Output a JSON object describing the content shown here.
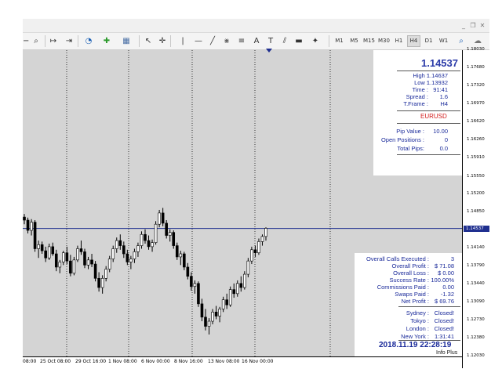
{
  "window": {
    "controls": [
      {
        "name": "minimize-button",
        "glyph": "_"
      },
      {
        "name": "restore-button",
        "glyph": "❐"
      },
      {
        "name": "close-button",
        "glyph": "✕"
      }
    ]
  },
  "toolbar": {
    "icons": [
      {
        "name": "zoom-out-icon",
        "glyph": "−"
      },
      {
        "name": "zoom-icon",
        "glyph": "⌕"
      },
      {
        "name": "chart-shift-icon",
        "glyph": "↦"
      },
      {
        "name": "autoscroll-icon",
        "glyph": "⇥"
      },
      {
        "name": "clock-icon",
        "glyph": "◔"
      },
      {
        "name": "add-indicator-icon",
        "glyph": "✚"
      },
      {
        "name": "templates-icon",
        "glyph": "▦"
      },
      {
        "name": "cursor-icon",
        "glyph": "↖"
      },
      {
        "name": "crosshair-icon",
        "glyph": "✛"
      },
      {
        "name": "vertical-line-icon",
        "glyph": "|"
      },
      {
        "name": "horizontal-line-icon",
        "glyph": "—"
      },
      {
        "name": "trendline-icon",
        "glyph": "╱"
      },
      {
        "name": "channel-icon",
        "glyph": "⨳"
      },
      {
        "name": "fibonacci-icon",
        "glyph": "≡"
      },
      {
        "name": "text-icon",
        "glyph": "A"
      },
      {
        "name": "text-label-icon",
        "glyph": "T"
      },
      {
        "name": "gann-icon",
        "glyph": "⫽"
      },
      {
        "name": "rectangle-icon",
        "glyph": "▬"
      },
      {
        "name": "shapes-icon",
        "glyph": "✦"
      }
    ],
    "timeframes": [
      "M1",
      "M5",
      "M15",
      "M30",
      "H1",
      "H4",
      "D1",
      "W1"
    ],
    "active_timeframe": "H4",
    "search_icon": "⌕",
    "chat_icon": "☁"
  },
  "chart": {
    "symbol": "EURUSD",
    "timeframe": "H4",
    "price_axis": [
      "1.18030",
      "1.17680",
      "1.17320",
      "1.16970",
      "1.16620",
      "1.16260",
      "1.15910",
      "1.15550",
      "1.15200",
      "1.14850",
      "1.14537",
      "1.14140",
      "1.13790",
      "1.13440",
      "1.13090",
      "1.12730",
      "1.12380",
      "1.12030"
    ],
    "current_price_label": "1.14537",
    "time_axis": [
      "08:00",
      "25 Oct 08:00",
      "29 Oct 16:00",
      "1 Nov 08:00",
      "6 Nov 00:00",
      "8 Nov 16:00",
      "13 Nov 08:00",
      "16 Nov 00:00"
    ],
    "colors": {
      "background": "#d4d4d4",
      "bull": "#ffffff",
      "bear": "#000000",
      "price_line": "#1f2f8f"
    },
    "candles": [
      [
        1.1476,
        1.1482,
        1.1462,
        1.147
      ],
      [
        1.147,
        1.1475,
        1.1444,
        1.145
      ],
      [
        1.145,
        1.1472,
        1.144,
        1.1466
      ],
      [
        1.1466,
        1.147,
        1.1408,
        1.1414
      ],
      [
        1.1414,
        1.143,
        1.1396,
        1.1422
      ],
      [
        1.1422,
        1.1428,
        1.1404,
        1.141
      ],
      [
        1.141,
        1.1418,
        1.1388,
        1.1396
      ],
      [
        1.1396,
        1.1424,
        1.1392,
        1.1418
      ],
      [
        1.1418,
        1.1426,
        1.14,
        1.1404
      ],
      [
        1.1404,
        1.1412,
        1.137,
        1.1378
      ],
      [
        1.1378,
        1.1392,
        1.1366,
        1.1388
      ],
      [
        1.1388,
        1.141,
        1.1382,
        1.1406
      ],
      [
        1.1406,
        1.1418,
        1.1384,
        1.139
      ],
      [
        1.139,
        1.1402,
        1.136,
        1.1366
      ],
      [
        1.1366,
        1.1398,
        1.1362,
        1.1392
      ],
      [
        1.1392,
        1.142,
        1.1388,
        1.1414
      ],
      [
        1.1414,
        1.143,
        1.1402,
        1.1408
      ],
      [
        1.1408,
        1.1414,
        1.1376,
        1.1382
      ],
      [
        1.1382,
        1.1398,
        1.1374,
        1.1392
      ],
      [
        1.1392,
        1.1404,
        1.1378,
        1.1384
      ],
      [
        1.1384,
        1.139,
        1.135,
        1.1356
      ],
      [
        1.1356,
        1.1368,
        1.133,
        1.1338
      ],
      [
        1.1338,
        1.1362,
        1.1326,
        1.1356
      ],
      [
        1.1356,
        1.138,
        1.135,
        1.1374
      ],
      [
        1.1374,
        1.14,
        1.1368,
        1.1394
      ],
      [
        1.1394,
        1.142,
        1.1388,
        1.1414
      ],
      [
        1.1414,
        1.1436,
        1.1406,
        1.143
      ],
      [
        1.143,
        1.1442,
        1.1412,
        1.142
      ],
      [
        1.142,
        1.1428,
        1.1396,
        1.1404
      ],
      [
        1.1404,
        1.1412,
        1.1382,
        1.1388
      ],
      [
        1.1388,
        1.14,
        1.1374,
        1.1394
      ],
      [
        1.1394,
        1.1414,
        1.1386,
        1.1408
      ],
      [
        1.1408,
        1.1426,
        1.1398,
        1.142
      ],
      [
        1.142,
        1.1448,
        1.1414,
        1.1442
      ],
      [
        1.1442,
        1.1452,
        1.1424,
        1.143
      ],
      [
        1.143,
        1.144,
        1.1412,
        1.1418
      ],
      [
        1.1418,
        1.1432,
        1.1408,
        1.1426
      ],
      [
        1.1426,
        1.1468,
        1.1422,
        1.1462
      ],
      [
        1.1462,
        1.149,
        1.1456,
        1.1484
      ],
      [
        1.1484,
        1.1494,
        1.1458,
        1.1464
      ],
      [
        1.1464,
        1.147,
        1.1434,
        1.144
      ],
      [
        1.144,
        1.1452,
        1.1428,
        1.1446
      ],
      [
        1.1446,
        1.145,
        1.1414,
        1.142
      ],
      [
        1.142,
        1.1426,
        1.1392,
        1.1398
      ],
      [
        1.1398,
        1.141,
        1.1382,
        1.1404
      ],
      [
        1.1404,
        1.1408,
        1.1372,
        1.1378
      ],
      [
        1.1378,
        1.1386,
        1.1354,
        1.136
      ],
      [
        1.136,
        1.1368,
        1.1332,
        1.134
      ],
      [
        1.134,
        1.1352,
        1.1326,
        1.1346
      ],
      [
        1.1346,
        1.135,
        1.13,
        1.1306
      ],
      [
        1.1306,
        1.1316,
        1.1272,
        1.128
      ],
      [
        1.128,
        1.1296,
        1.1254,
        1.1262
      ],
      [
        1.1262,
        1.1278,
        1.1246,
        1.1272
      ],
      [
        1.1272,
        1.1296,
        1.1266,
        1.129
      ],
      [
        1.129,
        1.1302,
        1.1276,
        1.1282
      ],
      [
        1.1282,
        1.13,
        1.127,
        1.1296
      ],
      [
        1.1296,
        1.132,
        1.129,
        1.1314
      ],
      [
        1.1314,
        1.1326,
        1.1296,
        1.1304
      ],
      [
        1.1304,
        1.134,
        1.13,
        1.1334
      ],
      [
        1.1334,
        1.1346,
        1.1318,
        1.1326
      ],
      [
        1.1326,
        1.1352,
        1.132,
        1.1346
      ],
      [
        1.1346,
        1.136,
        1.133,
        1.1338
      ],
      [
        1.1338,
        1.137,
        1.1334,
        1.1364
      ],
      [
        1.1364,
        1.1396,
        1.1358,
        1.139
      ],
      [
        1.139,
        1.1418,
        1.1384,
        1.1412
      ],
      [
        1.1412,
        1.142,
        1.1398,
        1.1406
      ],
      [
        1.1406,
        1.1434,
        1.1402,
        1.1428
      ],
      [
        1.1428,
        1.1442,
        1.142,
        1.1438
      ],
      [
        1.1438,
        1.1456,
        1.143,
        1.1454
      ]
    ],
    "price_range": [
      1.1203,
      1.1803
    ]
  },
  "info_panel": {
    "price": "1.14537",
    "stats": [
      {
        "label": "High :",
        "value": "1.14637"
      },
      {
        "label": "Low :",
        "value": "1.13932"
      },
      {
        "label": "Time :",
        "value": "91:41"
      },
      {
        "label": "Spread :",
        "value": "1.6"
      },
      {
        "label": "T.Frame :",
        "value": "H4"
      }
    ],
    "symbol": "EURUSD",
    "account": [
      {
        "label": "Pip Value :",
        "value": "10.00"
      },
      {
        "label": "Open Positions :",
        "value": "0"
      },
      {
        "label": "Total Pips:",
        "value": "0.0"
      }
    ],
    "summary": [
      {
        "label": "Overall Calls Executed :",
        "value": "3"
      },
      {
        "label": "Overall Profit :",
        "value": "$ 71.08"
      },
      {
        "label": "Overall Loss :",
        "value": "$ 0.00"
      },
      {
        "label": "Success Rate :",
        "value": "100.00%"
      },
      {
        "label": "Commissions Paid :",
        "value": "0.00"
      },
      {
        "label": "Swaps Paid :",
        "value": "-1.32"
      },
      {
        "label": "Net Profit :",
        "value": "$ 69.76"
      }
    ],
    "sessions": [
      {
        "label": "Sydney :",
        "value": "Closed!"
      },
      {
        "label": "Tokyo :",
        "value": "Closed!"
      },
      {
        "label": "London :",
        "value": "Closed!"
      },
      {
        "label": "New York :",
        "value": "1:31:41"
      }
    ],
    "datetime": "2018.11.19 22:28:19",
    "footer": "Info Plus"
  }
}
